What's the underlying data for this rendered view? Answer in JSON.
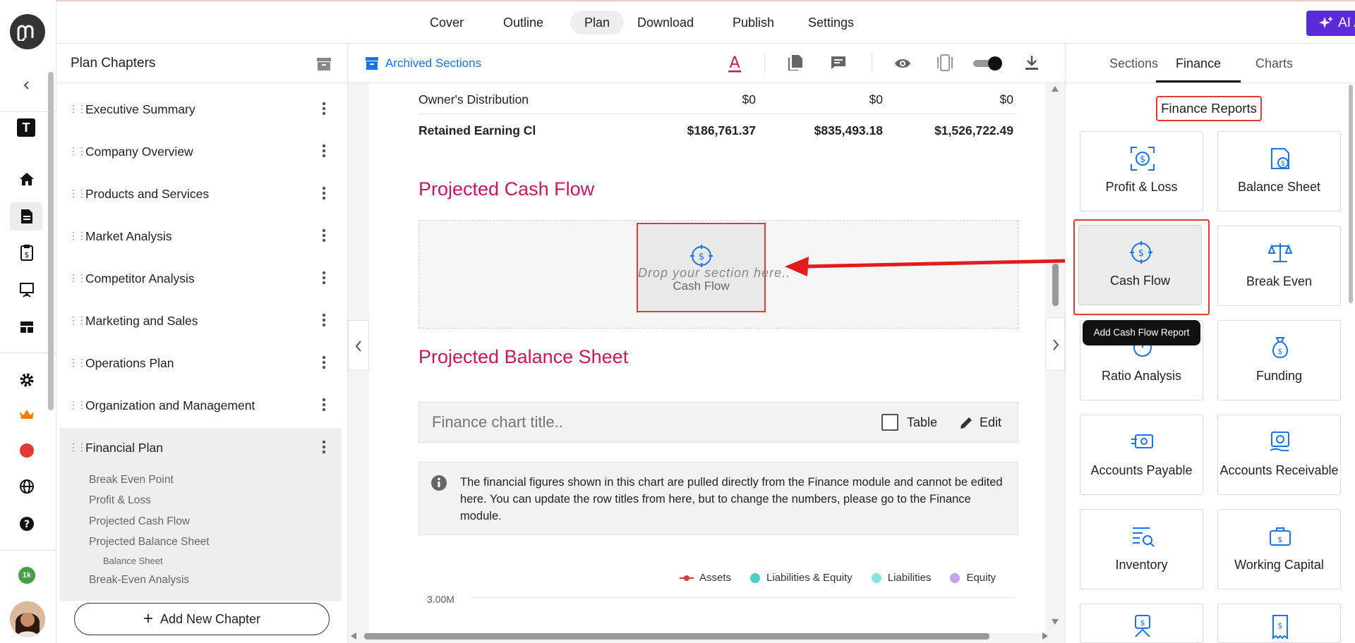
{
  "topnav": {
    "tabs": [
      "Cover",
      "Outline",
      "Plan",
      "Download",
      "Publish",
      "Settings"
    ],
    "active": "Plan",
    "ai_assist": "AI Assist"
  },
  "rail": {
    "workspace_letter": "T",
    "credits_badge": "1k",
    "colors": {
      "brand": "#333333",
      "credits": "#43a047",
      "record": "#e53935",
      "crown": "#ff7a00"
    }
  },
  "chapters": {
    "title": "Plan Chapters",
    "items": [
      "Executive Summary",
      "Company Overview",
      "Products and Services",
      "Market Analysis",
      "Competitor Analysis",
      "Marketing and Sales",
      "Operations Plan",
      "Organization and Management",
      "Financial Plan"
    ],
    "active": "Financial Plan",
    "subitems": [
      "Break Even Point",
      "Profit & Loss",
      "Projected Cash Flow",
      "Projected Balance Sheet"
    ],
    "subsub": "Balance Sheet",
    "last_sub": "Break-Even Analysis",
    "add_button": "Add New Chapter"
  },
  "toolbar": {
    "archived": "Archived Sections"
  },
  "doc": {
    "rows": [
      {
        "label": "Owner's Distribution",
        "values": [
          "$0",
          "$0",
          "$0"
        ]
      },
      {
        "label": "Retained Earning Cl",
        "values": [
          "$186,761.37",
          "$835,493.18",
          "$1,526,722.49"
        ]
      }
    ],
    "cashflow_heading": "Projected Cash Flow",
    "drop_text": "Drop your section here..",
    "drag_card_label": "Cash Flow",
    "balance_heading": "Projected Balance Sheet",
    "chart_title_placeholder": "Finance chart title..",
    "table_label": "Table",
    "edit_label": "Edit",
    "info": "The financial figures shown in this chart are pulled directly from the Finance module and cannot be edited here. You can update the row titles from here, but to change the numbers, please go to the Finance module.",
    "legend": [
      {
        "name": "Assets",
        "color": "#e53935"
      },
      {
        "name": "Liabilities & Equity",
        "color": "#4dd0c8"
      },
      {
        "name": "Liabilities",
        "color": "#80e5e5"
      },
      {
        "name": "Equity",
        "color": "#c9a3e8"
      }
    ],
    "y_tick": "3.00M"
  },
  "right": {
    "tabs": [
      "Sections",
      "Finance",
      "Charts"
    ],
    "active": "Finance",
    "heading": "Finance Reports",
    "cards": [
      "Profit & Loss",
      "Balance Sheet",
      "Cash Flow",
      "Break Even",
      "Ratio Analysis",
      "Funding",
      "Accounts Payable",
      "Accounts Receivable",
      "Inventory",
      "Working Capital"
    ],
    "tooltip": "Add Cash Flow Report"
  }
}
